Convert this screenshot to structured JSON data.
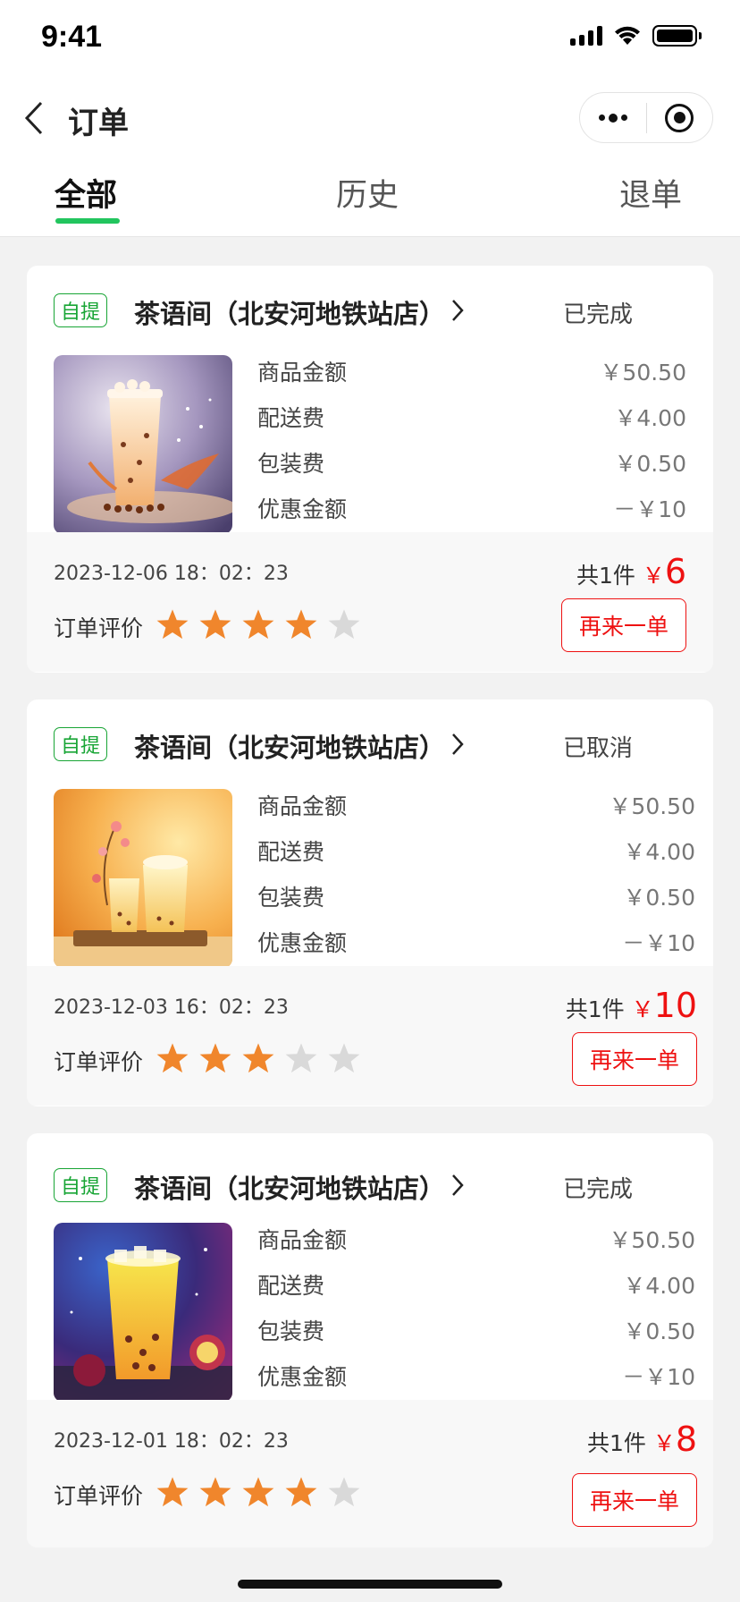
{
  "status_bar": {
    "time": "9:41"
  },
  "nav": {
    "title": "订单"
  },
  "tabs": [
    {
      "label": "全部",
      "active": true
    },
    {
      "label": "历史",
      "active": false
    },
    {
      "label": "退单",
      "active": false
    }
  ],
  "colors": {
    "accent_green": "#22c55e",
    "badge_green": "#18a535",
    "price_red": "#e11111",
    "star_on": "#f0862c",
    "star_off": "#d9d9d9"
  },
  "icons": [
    "back-chevron-icon",
    "more-dots-icon",
    "target-icon",
    "chevron-right-icon",
    "star-icon"
  ],
  "orders": [
    {
      "badge": "自提",
      "shop": "茶语间（北安河地铁站店）",
      "status": "已完成",
      "fees": [
        {
          "label": "商品金额",
          "value": "￥50.50"
        },
        {
          "label": "配送费",
          "value": "￥4.00"
        },
        {
          "label": "包装费",
          "value": "￥0.50"
        },
        {
          "label": "优惠金额",
          "value": "－￥10"
        }
      ],
      "time": "2023-12-06 18：02：23",
      "count": "共1件",
      "currency": "￥",
      "total": "6",
      "rating_label": "订单评价",
      "rating": 4,
      "reorder": "再来一单"
    },
    {
      "badge": "自提",
      "shop": "茶语间（北安河地铁站店）",
      "status": "已取消",
      "fees": [
        {
          "label": "商品金额",
          "value": "￥50.50"
        },
        {
          "label": "配送费",
          "value": "￥4.00"
        },
        {
          "label": "包装费",
          "value": "￥0.50"
        },
        {
          "label": "优惠金额",
          "value": "－￥10"
        }
      ],
      "time": "2023-12-03 16：02：23",
      "count": "共1件",
      "currency": "￥",
      "total": "10",
      "rating_label": "订单评价",
      "rating": 3,
      "reorder": "再来一单"
    },
    {
      "badge": "自提",
      "shop": "茶语间（北安河地铁站店）",
      "status": "已完成",
      "fees": [
        {
          "label": "商品金额",
          "value": "￥50.50"
        },
        {
          "label": "配送费",
          "value": "￥4.00"
        },
        {
          "label": "包装费",
          "value": "￥0.50"
        },
        {
          "label": "优惠金额",
          "value": "－￥10"
        }
      ],
      "time": "2023-12-01 18：02：23",
      "count": "共1件",
      "currency": "￥",
      "total": "8",
      "rating_label": "订单评价",
      "rating": 4,
      "reorder": "再来一单"
    }
  ]
}
